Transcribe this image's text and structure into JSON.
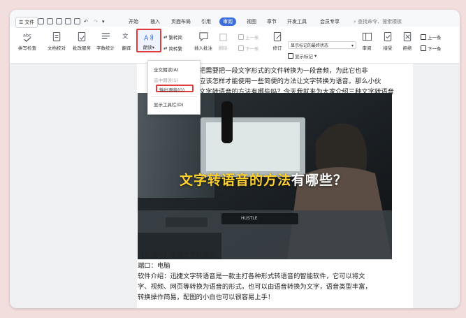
{
  "menu": {
    "file_label": "文件",
    "tabs": [
      "开始",
      "插入",
      "页面布局",
      "引用",
      "审阅",
      "视图",
      "章节",
      "开发工具",
      "会员专享"
    ],
    "active_tab": "审阅",
    "search_placeholder": "查找命令、搜索模板"
  },
  "ribbon": {
    "spellcheck": "拼写检查",
    "proofread": "文档校对",
    "batch_service": "批改服务",
    "word_count": "字数统计",
    "translate": "翻译",
    "read_aloud": "朗读",
    "simplified": "繁转简",
    "traditional": "简转繁",
    "insert_comment": "插入批注",
    "delete": "删除",
    "prev": "上一条",
    "next": "下一条",
    "track": "修订",
    "status_select": "显示标记的最终状态",
    "show_markup": "显示标记",
    "review": "审阅",
    "accept": "接受",
    "reject": "拒绝",
    "prev2": "上一条",
    "next2": "下一条"
  },
  "read_menu": {
    "full_read": "全文朗读(A)",
    "selection_read": "选中朗读(S)",
    "output_audio": "输出语音(O)",
    "show_toolbar": "显示工具栏(D)"
  },
  "document": {
    "line1": "把需要把一段文字形式的文件转换为一段音频，为此它也非",
    "line2": "应该怎样才能使用一些简便的方法让文字转换为语音。那么小伙",
    "line3": "文字转语音的方法有哪些吗？今天我就来为大家介绍三种文字转语音",
    "image_title_main": "文字转语音的方法",
    "image_title_tail": "有哪些？",
    "keyboard_brand": "HUSTLE",
    "method_title": "【方法一】使用文字转语音",
    "platform": "端口：电脑",
    "intro1": "软件介绍：迅捷文字转语音是一款主打各种形式转语音的智能软件，它可以将文",
    "intro2": "字、视频、网页等转换为语音的形式，也可以由语音转换为文字，语音类型丰富，",
    "intro3": "转换操作简易，配图的小白也可以很容易上手！"
  },
  "colors": {
    "accent": "#3b6fe0",
    "highlight_red": "#e23b3b",
    "title_yellow": "#ffd230"
  }
}
